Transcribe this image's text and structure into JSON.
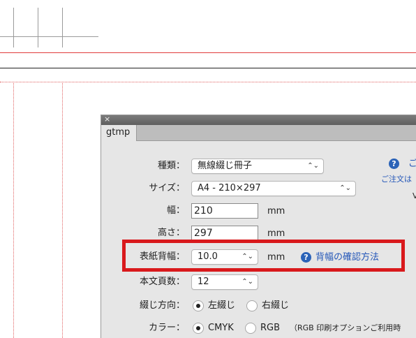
{
  "panel": {
    "close_glyph": "×",
    "tab_label": "gtmp",
    "kind": {
      "label": "種類：",
      "value": "無線綴じ冊子"
    },
    "size": {
      "label": "サイズ：",
      "value": "A4 - 210×297"
    },
    "width": {
      "label": "幅：",
      "value": "210",
      "unit": "mm"
    },
    "height": {
      "label": "高さ：",
      "value": "297",
      "unit": "mm"
    },
    "spine": {
      "label": "表紙背幅：",
      "value": "10.0",
      "unit": "mm",
      "help_link": "背幅の確認方法"
    },
    "body_pages": {
      "label": "本文頁数：",
      "value": "12"
    },
    "binding": {
      "label": "綴じ方向：",
      "options": [
        "左綴じ",
        "右綴じ"
      ],
      "selected": "左綴じ"
    },
    "color": {
      "label": "カラー：",
      "options": [
        "CMYK",
        "RGB"
      ],
      "selected": "CMYK",
      "note": "（RGB 印刷オプションご利用時"
    },
    "side_info": {
      "help_text": "ご",
      "order_text": "ご注文は",
      "extra_text": "V"
    }
  },
  "colors": {
    "accent_link": "#2356b8",
    "highlight": "#d9191c",
    "guide": "#e06060"
  },
  "icons": {
    "help": "question-circle-icon",
    "stepper": "updown-chevron-icon",
    "close": "close-icon"
  }
}
